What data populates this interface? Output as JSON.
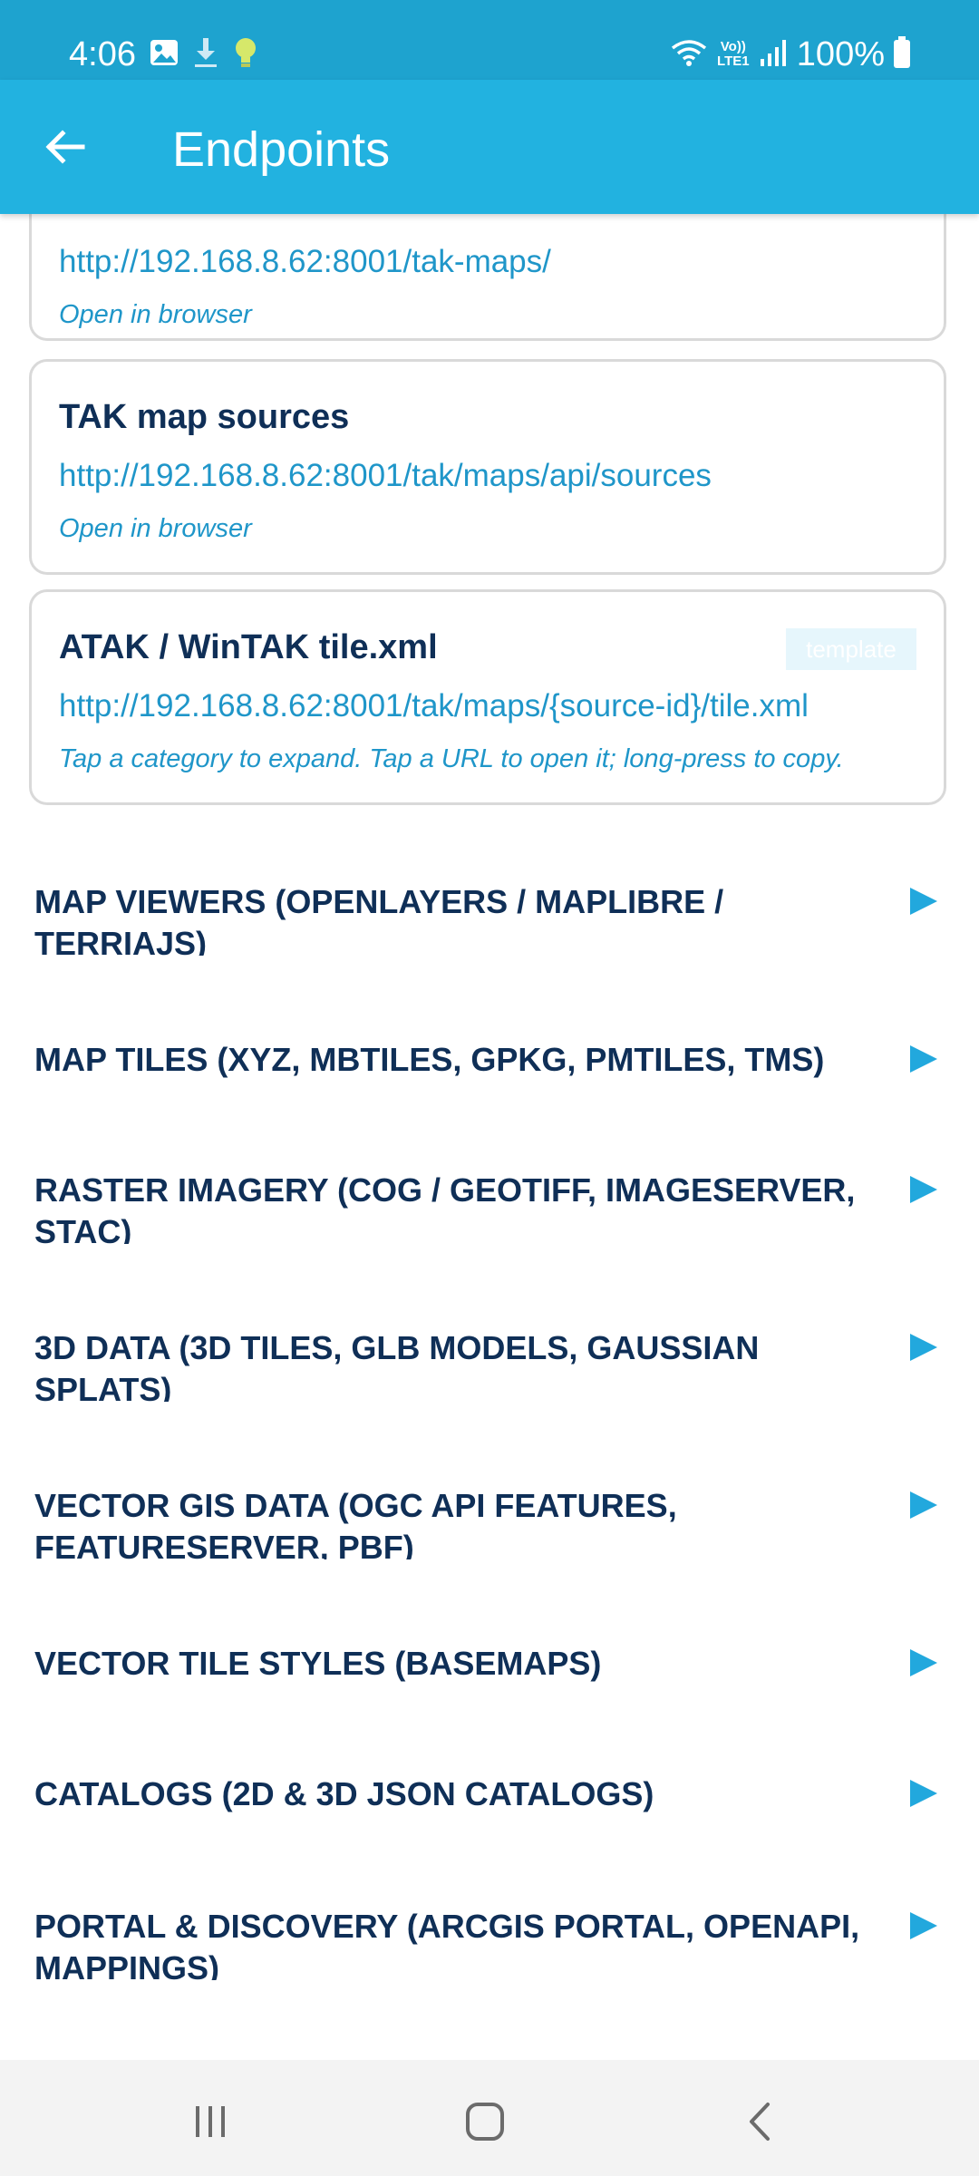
{
  "status_bar": {
    "time": "4:06",
    "battery": "100%",
    "network_label": "Vo)) LTE1",
    "icons_left": [
      "image-icon",
      "download-icon",
      "lightbulb-icon"
    ],
    "icons_right": [
      "wifi-icon",
      "signal-icon",
      "battery-icon"
    ]
  },
  "app_bar": {
    "title": "Endpoints",
    "back_icon": "arrow-left-icon",
    "color": "#22b2e0"
  },
  "cards": [
    {
      "title": "",
      "url": "http://192.168.8.62:8001/tak-maps/",
      "note": "Open in browser"
    },
    {
      "title": "TAK map sources",
      "url": "http://192.168.8.62:8001/tak/maps/api/sources",
      "note": "Open in browser"
    },
    {
      "title": "ATAK / WinTAK tile.xml",
      "badge": "template",
      "url": "http://192.168.8.62:8001/tak/maps/{source-id}/tile.xml",
      "note": "Tap a category to expand. Tap a URL to open it; long-press to copy."
    }
  ],
  "categories": [
    {
      "label": "MAP VIEWERS (OPENLAYERS / MAPLIBRE / TERRIAJS)"
    },
    {
      "label": "MAP TILES (XYZ, MBTILES, GPKG, PMTILES, TMS)"
    },
    {
      "label": "RASTER IMAGERY (COG / GEOTIFF, IMAGESERVER, STAC)"
    },
    {
      "label": "3D DATA (3D TILES, GLB MODELS, GAUSSIAN SPLATS)"
    },
    {
      "label": "VECTOR GIS DATA (OGC API FEATURES, FEATURESERVER, PBF)"
    },
    {
      "label": "VECTOR TILE STYLES (BASEMAPS)"
    },
    {
      "label": "CATALOGS (2D & 3D JSON CATALOGS)"
    },
    {
      "label": "PORTAL & DISCOVERY (ARCGIS PORTAL, OPENAPI, MAPPINGS)"
    }
  ],
  "colors": {
    "status_bar": "#1ea3cf",
    "accent": "#22b2e0",
    "title_text": "#0f2f57",
    "link_text": "#1f96c9"
  },
  "nav_bar": {
    "icons": [
      "recents-icon",
      "home-icon",
      "back-icon"
    ]
  }
}
